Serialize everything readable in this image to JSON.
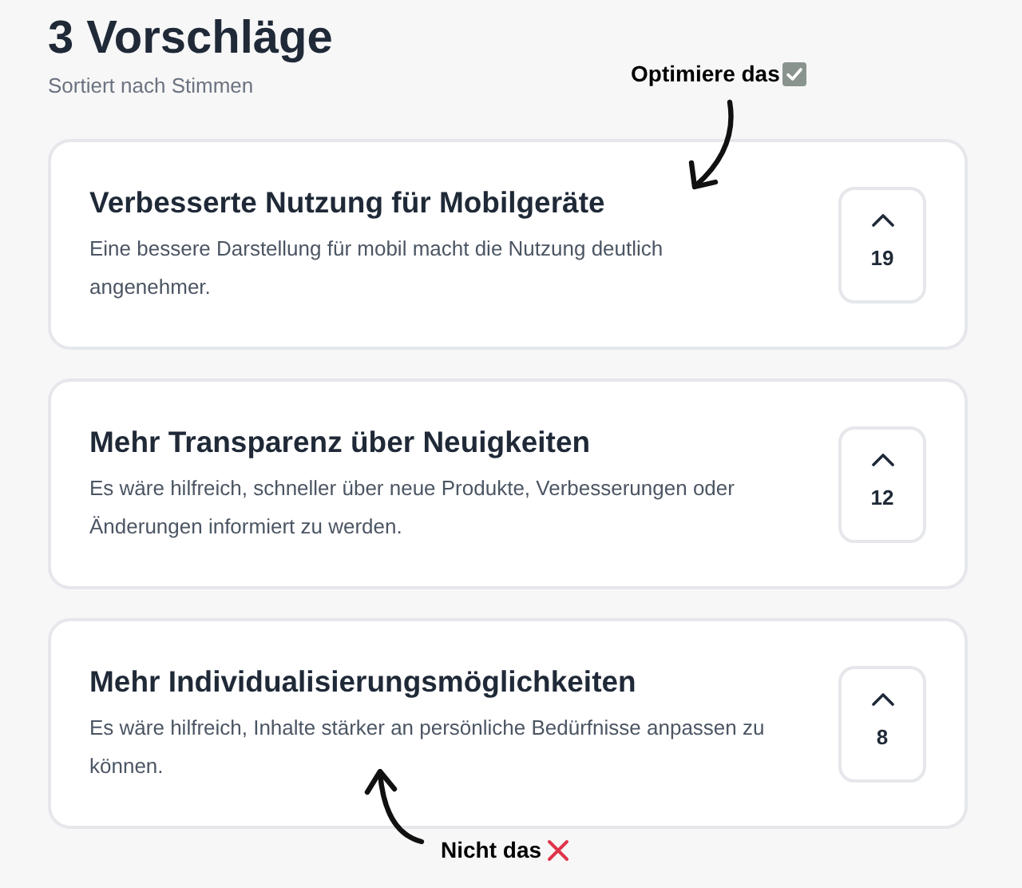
{
  "header": {
    "title": "3 Vorschläge",
    "subtitle": "Sortiert nach Stimmen"
  },
  "suggestions": [
    {
      "title": "Verbesserte Nutzung für Mobilgeräte",
      "description": "Eine bessere Darstellung für mobil macht die Nutzung deutlich angenehmer.",
      "votes": "19"
    },
    {
      "title": "Mehr Transparenz über Neuigkeiten",
      "description": "Es wäre hilfreich, schneller über neue Produkte, Verbesserungen oder Änderungen informiert zu werden.",
      "votes": "12"
    },
    {
      "title": "Mehr Individualisierungsmöglichkeiten",
      "description": "Es wäre hilfreich, Inhalte stärker an persönliche Bedürfnisse anpassen zu können.",
      "votes": "8"
    }
  ],
  "annotations": [
    {
      "text": "Optimiere das",
      "kind": "good"
    },
    {
      "text": "Nicht das",
      "kind": "bad"
    }
  ]
}
